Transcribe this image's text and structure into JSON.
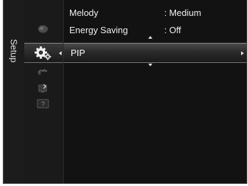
{
  "sidebar": {
    "title": "Setup",
    "icons": [
      {
        "name": "picture-icon"
      },
      {
        "name": "setup-gear-icon"
      },
      {
        "name": "sound-icon"
      },
      {
        "name": "input-icon"
      },
      {
        "name": "support-help-icon"
      }
    ]
  },
  "menu": {
    "rows": [
      {
        "label": "Melody",
        "value": ": Medium"
      },
      {
        "label": "Energy Saving",
        "value": ": Off"
      }
    ],
    "selected": {
      "label": "PIP"
    }
  },
  "colors": {
    "background": "#121212",
    "text": "#f0f0f0",
    "highlight_top": "#4a4a4a",
    "highlight_bottom": "#1a1a1a"
  }
}
